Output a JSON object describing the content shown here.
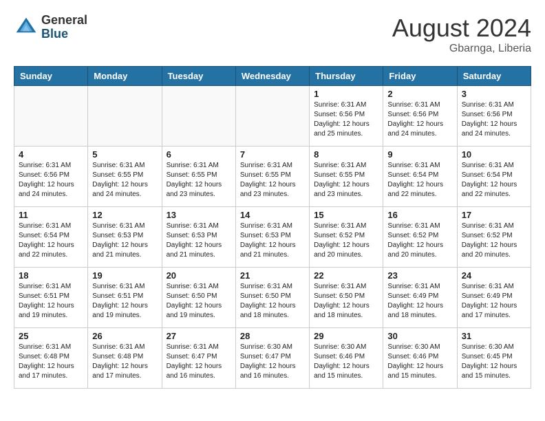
{
  "header": {
    "logo_general": "General",
    "logo_blue": "Blue",
    "month_year": "August 2024",
    "location": "Gbarnga, Liberia"
  },
  "weekdays": [
    "Sunday",
    "Monday",
    "Tuesday",
    "Wednesday",
    "Thursday",
    "Friday",
    "Saturday"
  ],
  "weeks": [
    [
      {
        "day": "",
        "info": ""
      },
      {
        "day": "",
        "info": ""
      },
      {
        "day": "",
        "info": ""
      },
      {
        "day": "",
        "info": ""
      },
      {
        "day": "1",
        "info": "Sunrise: 6:31 AM\nSunset: 6:56 PM\nDaylight: 12 hours\nand 25 minutes."
      },
      {
        "day": "2",
        "info": "Sunrise: 6:31 AM\nSunset: 6:56 PM\nDaylight: 12 hours\nand 24 minutes."
      },
      {
        "day": "3",
        "info": "Sunrise: 6:31 AM\nSunset: 6:56 PM\nDaylight: 12 hours\nand 24 minutes."
      }
    ],
    [
      {
        "day": "4",
        "info": "Sunrise: 6:31 AM\nSunset: 6:56 PM\nDaylight: 12 hours\nand 24 minutes."
      },
      {
        "day": "5",
        "info": "Sunrise: 6:31 AM\nSunset: 6:55 PM\nDaylight: 12 hours\nand 24 minutes."
      },
      {
        "day": "6",
        "info": "Sunrise: 6:31 AM\nSunset: 6:55 PM\nDaylight: 12 hours\nand 23 minutes."
      },
      {
        "day": "7",
        "info": "Sunrise: 6:31 AM\nSunset: 6:55 PM\nDaylight: 12 hours\nand 23 minutes."
      },
      {
        "day": "8",
        "info": "Sunrise: 6:31 AM\nSunset: 6:55 PM\nDaylight: 12 hours\nand 23 minutes."
      },
      {
        "day": "9",
        "info": "Sunrise: 6:31 AM\nSunset: 6:54 PM\nDaylight: 12 hours\nand 22 minutes."
      },
      {
        "day": "10",
        "info": "Sunrise: 6:31 AM\nSunset: 6:54 PM\nDaylight: 12 hours\nand 22 minutes."
      }
    ],
    [
      {
        "day": "11",
        "info": "Sunrise: 6:31 AM\nSunset: 6:54 PM\nDaylight: 12 hours\nand 22 minutes."
      },
      {
        "day": "12",
        "info": "Sunrise: 6:31 AM\nSunset: 6:53 PM\nDaylight: 12 hours\nand 21 minutes."
      },
      {
        "day": "13",
        "info": "Sunrise: 6:31 AM\nSunset: 6:53 PM\nDaylight: 12 hours\nand 21 minutes."
      },
      {
        "day": "14",
        "info": "Sunrise: 6:31 AM\nSunset: 6:53 PM\nDaylight: 12 hours\nand 21 minutes."
      },
      {
        "day": "15",
        "info": "Sunrise: 6:31 AM\nSunset: 6:52 PM\nDaylight: 12 hours\nand 20 minutes."
      },
      {
        "day": "16",
        "info": "Sunrise: 6:31 AM\nSunset: 6:52 PM\nDaylight: 12 hours\nand 20 minutes."
      },
      {
        "day": "17",
        "info": "Sunrise: 6:31 AM\nSunset: 6:52 PM\nDaylight: 12 hours\nand 20 minutes."
      }
    ],
    [
      {
        "day": "18",
        "info": "Sunrise: 6:31 AM\nSunset: 6:51 PM\nDaylight: 12 hours\nand 19 minutes."
      },
      {
        "day": "19",
        "info": "Sunrise: 6:31 AM\nSunset: 6:51 PM\nDaylight: 12 hours\nand 19 minutes."
      },
      {
        "day": "20",
        "info": "Sunrise: 6:31 AM\nSunset: 6:50 PM\nDaylight: 12 hours\nand 19 minutes."
      },
      {
        "day": "21",
        "info": "Sunrise: 6:31 AM\nSunset: 6:50 PM\nDaylight: 12 hours\nand 18 minutes."
      },
      {
        "day": "22",
        "info": "Sunrise: 6:31 AM\nSunset: 6:50 PM\nDaylight: 12 hours\nand 18 minutes."
      },
      {
        "day": "23",
        "info": "Sunrise: 6:31 AM\nSunset: 6:49 PM\nDaylight: 12 hours\nand 18 minutes."
      },
      {
        "day": "24",
        "info": "Sunrise: 6:31 AM\nSunset: 6:49 PM\nDaylight: 12 hours\nand 17 minutes."
      }
    ],
    [
      {
        "day": "25",
        "info": "Sunrise: 6:31 AM\nSunset: 6:48 PM\nDaylight: 12 hours\nand 17 minutes."
      },
      {
        "day": "26",
        "info": "Sunrise: 6:31 AM\nSunset: 6:48 PM\nDaylight: 12 hours\nand 17 minutes."
      },
      {
        "day": "27",
        "info": "Sunrise: 6:31 AM\nSunset: 6:47 PM\nDaylight: 12 hours\nand 16 minutes."
      },
      {
        "day": "28",
        "info": "Sunrise: 6:30 AM\nSunset: 6:47 PM\nDaylight: 12 hours\nand 16 minutes."
      },
      {
        "day": "29",
        "info": "Sunrise: 6:30 AM\nSunset: 6:46 PM\nDaylight: 12 hours\nand 15 minutes."
      },
      {
        "day": "30",
        "info": "Sunrise: 6:30 AM\nSunset: 6:46 PM\nDaylight: 12 hours\nand 15 minutes."
      },
      {
        "day": "31",
        "info": "Sunrise: 6:30 AM\nSunset: 6:45 PM\nDaylight: 12 hours\nand 15 minutes."
      }
    ]
  ]
}
